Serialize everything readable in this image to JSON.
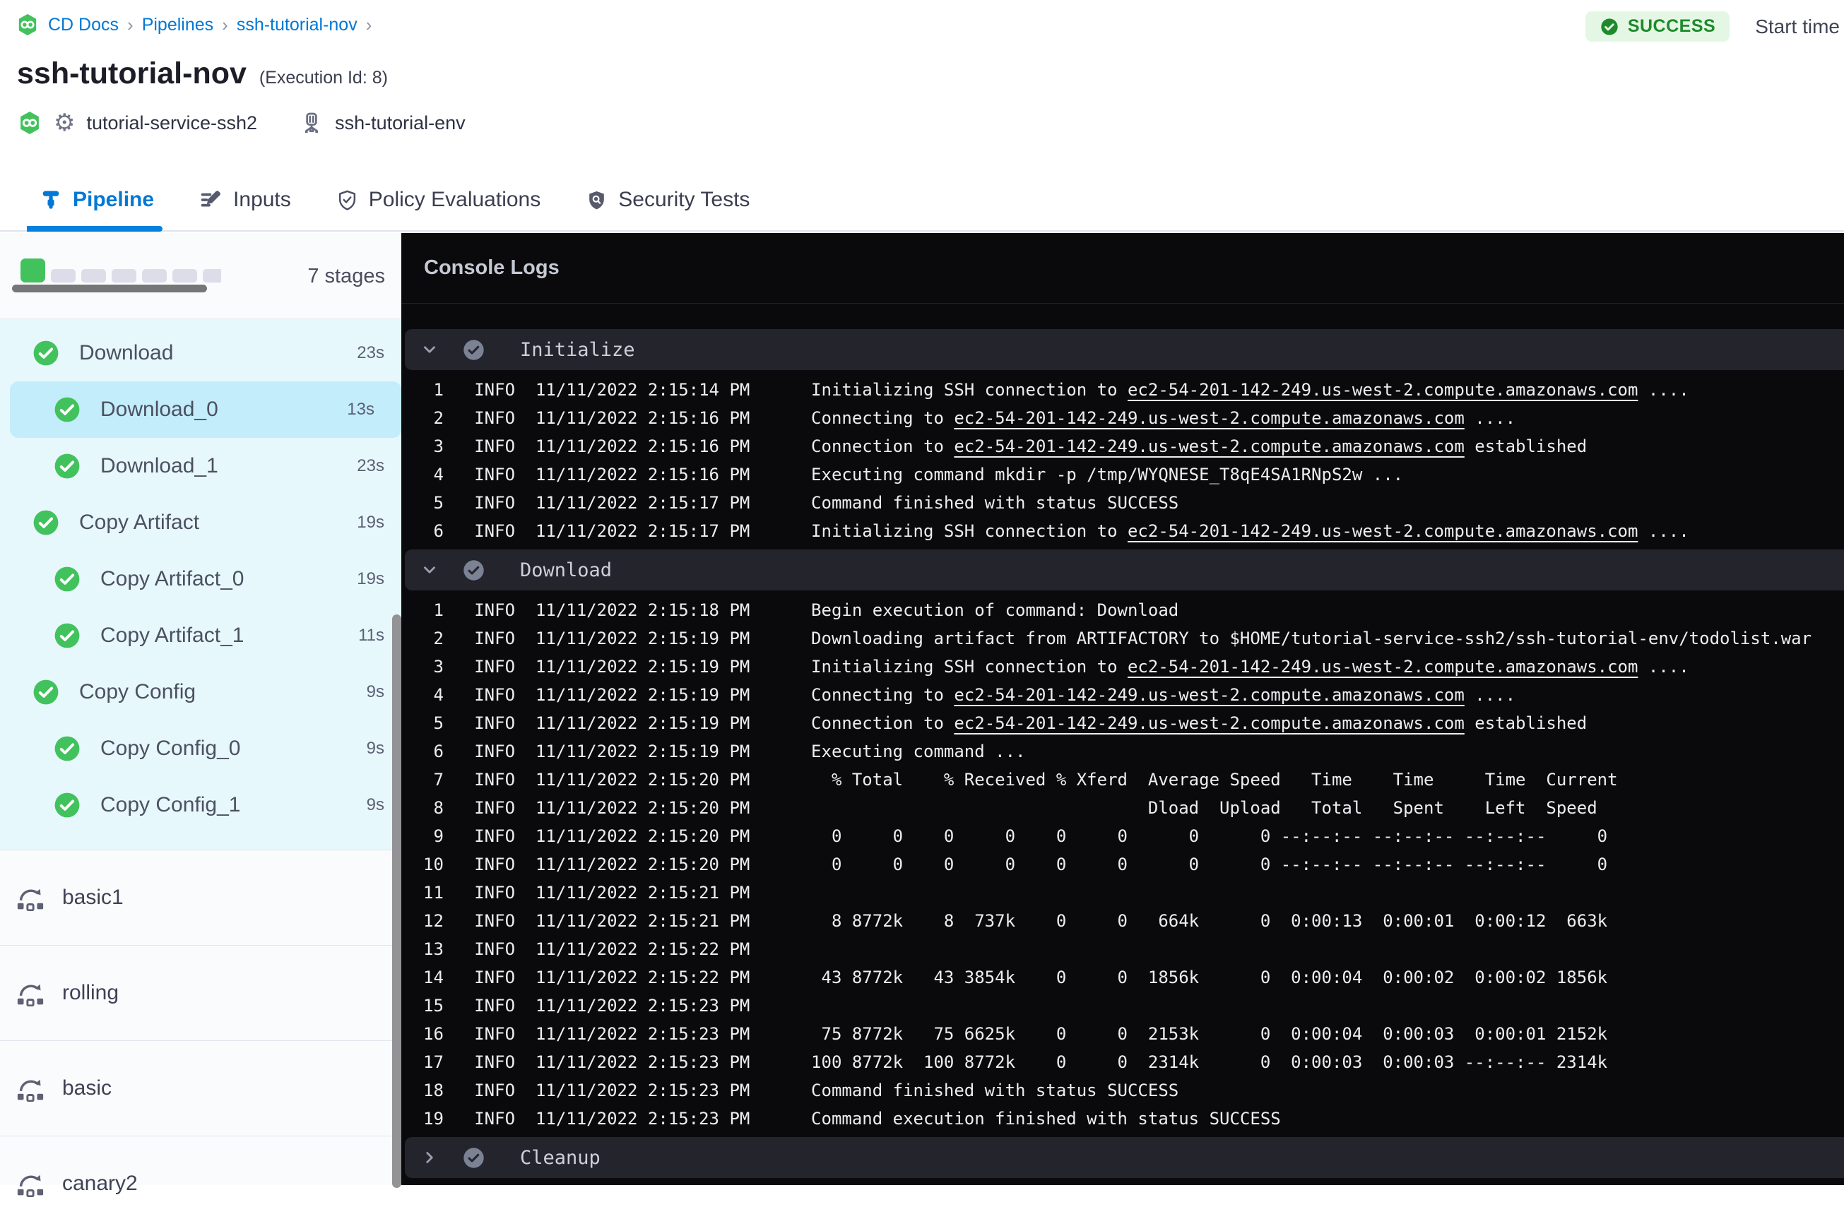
{
  "colors": {
    "accent_blue": "#0278d5",
    "success_green": "#42c25c",
    "badge_bg": "#e4f7e4",
    "badge_text": "#1e8a2b",
    "stage_tree_bg": "#e7f8fd",
    "selected_stage_bg": "#c3edfa",
    "console_bg": "#0a0a0d",
    "section_bar_bg": "#24242c"
  },
  "header": {
    "breadcrumb": [
      "CD Docs",
      "Pipelines",
      "ssh-tutorial-nov"
    ],
    "title": "ssh-tutorial-nov",
    "execution_id_label": "(Execution Id: 8)",
    "service_name": "tutorial-service-ssh2",
    "environment_name": "ssh-tutorial-env",
    "status_badge": "SUCCESS",
    "start_time_label": "Start time",
    "tabs": [
      {
        "label": "Pipeline",
        "icon": "pipeline",
        "active": true
      },
      {
        "label": "Inputs",
        "icon": "inputs",
        "active": false
      },
      {
        "label": "Policy Evaluations",
        "icon": "policy",
        "active": false
      },
      {
        "label": "Security Tests",
        "icon": "security",
        "active": false
      }
    ]
  },
  "sidebar": {
    "stages_count_label": "7 stages",
    "minimap": {
      "total": 7,
      "completed": 1
    },
    "stages": [
      {
        "label": "Download",
        "duration": "23s",
        "level": 0,
        "selected": false
      },
      {
        "label": "Download_0",
        "duration": "13s",
        "level": 1,
        "selected": true
      },
      {
        "label": "Download_1",
        "duration": "23s",
        "level": 1,
        "selected": false
      },
      {
        "label": "Copy Artifact",
        "duration": "19s",
        "level": 0,
        "selected": false
      },
      {
        "label": "Copy Artifact_0",
        "duration": "19s",
        "level": 1,
        "selected": false
      },
      {
        "label": "Copy Artifact_1",
        "duration": "11s",
        "level": 1,
        "selected": false
      },
      {
        "label": "Copy Config",
        "duration": "9s",
        "level": 0,
        "selected": false
      },
      {
        "label": "Copy Config_0",
        "duration": "9s",
        "level": 1,
        "selected": false
      },
      {
        "label": "Copy Config_1",
        "duration": "9s",
        "level": 1,
        "selected": false
      }
    ],
    "pipelines": [
      "basic1",
      "rolling",
      "basic",
      "canary2"
    ]
  },
  "console": {
    "title": "Console Logs",
    "link_host": "ec2-54-201-142-249.us-west-2.compute.amazonaws.com",
    "sections": [
      {
        "name": "Initialize",
        "status": "success",
        "expanded": true,
        "lines": [
          {
            "n": 1,
            "level": "INFO",
            "time": "11/11/2022 2:15:14 PM",
            "msg": "Initializing SSH connection to ec2-54-201-142-249.us-west-2.compute.amazonaws.com ...."
          },
          {
            "n": 2,
            "level": "INFO",
            "time": "11/11/2022 2:15:16 PM",
            "msg": "Connecting to ec2-54-201-142-249.us-west-2.compute.amazonaws.com ...."
          },
          {
            "n": 3,
            "level": "INFO",
            "time": "11/11/2022 2:15:16 PM",
            "msg": "Connection to ec2-54-201-142-249.us-west-2.compute.amazonaws.com established"
          },
          {
            "n": 4,
            "level": "INFO",
            "time": "11/11/2022 2:15:16 PM",
            "msg": "Executing command mkdir -p /tmp/WYQNESE_T8qE4SA1RNpS2w ..."
          },
          {
            "n": 5,
            "level": "INFO",
            "time": "11/11/2022 2:15:17 PM",
            "msg": "Command finished with status SUCCESS"
          },
          {
            "n": 6,
            "level": "INFO",
            "time": "11/11/2022 2:15:17 PM",
            "msg": "Initializing SSH connection to ec2-54-201-142-249.us-west-2.compute.amazonaws.com ...."
          }
        ]
      },
      {
        "name": "Download",
        "status": "success",
        "expanded": true,
        "lines": [
          {
            "n": 1,
            "level": "INFO",
            "time": "11/11/2022 2:15:18 PM",
            "msg": "Begin execution of command: Download"
          },
          {
            "n": 2,
            "level": "INFO",
            "time": "11/11/2022 2:15:19 PM",
            "msg": "Downloading artifact from ARTIFACTORY to $HOME/tutorial-service-ssh2/ssh-tutorial-env/todolist.war"
          },
          {
            "n": 3,
            "level": "INFO",
            "time": "11/11/2022 2:15:19 PM",
            "msg": "Initializing SSH connection to ec2-54-201-142-249.us-west-2.compute.amazonaws.com ...."
          },
          {
            "n": 4,
            "level": "INFO",
            "time": "11/11/2022 2:15:19 PM",
            "msg": "Connecting to ec2-54-201-142-249.us-west-2.compute.amazonaws.com ...."
          },
          {
            "n": 5,
            "level": "INFO",
            "time": "11/11/2022 2:15:19 PM",
            "msg": "Connection to ec2-54-201-142-249.us-west-2.compute.amazonaws.com established"
          },
          {
            "n": 6,
            "level": "INFO",
            "time": "11/11/2022 2:15:19 PM",
            "msg": "Executing command ..."
          },
          {
            "n": 7,
            "level": "INFO",
            "time": "11/11/2022 2:15:20 PM",
            "msg": "  % Total    % Received % Xferd  Average Speed   Time    Time     Time  Current"
          },
          {
            "n": 8,
            "level": "INFO",
            "time": "11/11/2022 2:15:20 PM",
            "msg": "                                 Dload  Upload   Total   Spent    Left  Speed"
          },
          {
            "n": 9,
            "level": "INFO",
            "time": "11/11/2022 2:15:20 PM",
            "msg": "  0     0    0     0    0     0      0      0 --:--:-- --:--:-- --:--:--     0"
          },
          {
            "n": 10,
            "level": "INFO",
            "time": "11/11/2022 2:15:20 PM",
            "msg": "  0     0    0     0    0     0      0      0 --:--:-- --:--:-- --:--:--     0"
          },
          {
            "n": 11,
            "level": "INFO",
            "time": "11/11/2022 2:15:21 PM",
            "msg": ""
          },
          {
            "n": 12,
            "level": "INFO",
            "time": "11/11/2022 2:15:21 PM",
            "msg": "  8 8772k    8  737k    0     0   664k      0  0:00:13  0:00:01  0:00:12  663k"
          },
          {
            "n": 13,
            "level": "INFO",
            "time": "11/11/2022 2:15:22 PM",
            "msg": ""
          },
          {
            "n": 14,
            "level": "INFO",
            "time": "11/11/2022 2:15:22 PM",
            "msg": " 43 8772k   43 3854k    0     0  1856k      0  0:00:04  0:00:02  0:00:02 1856k"
          },
          {
            "n": 15,
            "level": "INFO",
            "time": "11/11/2022 2:15:23 PM",
            "msg": ""
          },
          {
            "n": 16,
            "level": "INFO",
            "time": "11/11/2022 2:15:23 PM",
            "msg": " 75 8772k   75 6625k    0     0  2153k      0  0:00:04  0:00:03  0:00:01 2152k"
          },
          {
            "n": 17,
            "level": "INFO",
            "time": "11/11/2022 2:15:23 PM",
            "msg": "100 8772k  100 8772k    0     0  2314k      0  0:00:03  0:00:03 --:--:-- 2314k"
          },
          {
            "n": 18,
            "level": "INFO",
            "time": "11/11/2022 2:15:23 PM",
            "msg": "Command finished with status SUCCESS"
          },
          {
            "n": 19,
            "level": "INFO",
            "time": "11/11/2022 2:15:23 PM",
            "msg": "Command execution finished with status SUCCESS"
          }
        ]
      },
      {
        "name": "Cleanup",
        "status": "success",
        "expanded": false,
        "lines": []
      }
    ]
  }
}
